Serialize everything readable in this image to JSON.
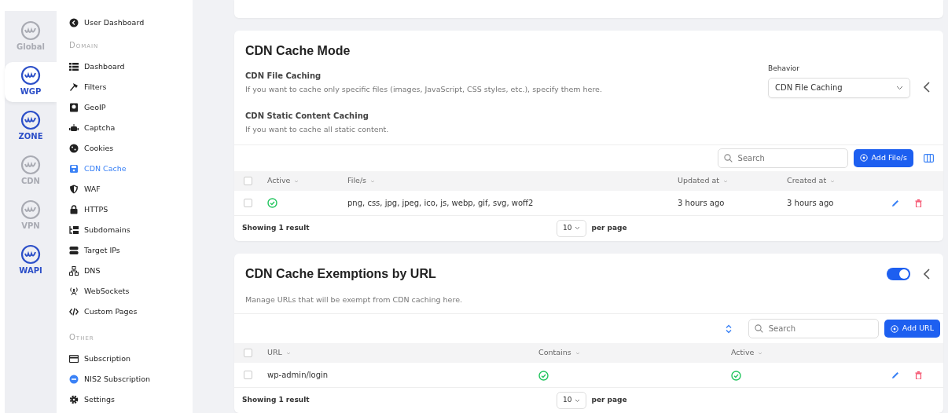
{
  "rail": [
    {
      "label": "Global",
      "selected": false,
      "disabled": true
    },
    {
      "label": "WGP",
      "selected": true,
      "disabled": false
    },
    {
      "label": "ZONE",
      "selected": false,
      "disabled": false
    },
    {
      "label": "CDN",
      "selected": false,
      "disabled": true
    },
    {
      "label": "VPN",
      "selected": false,
      "disabled": true
    },
    {
      "label": "WAPI",
      "selected": false,
      "disabled": false
    }
  ],
  "sidebar": {
    "top_item": {
      "label": "User Dashboard",
      "selected": false
    },
    "sections": [
      {
        "heading": "Domain",
        "items": [
          {
            "label": "Dashboard",
            "selected": false
          },
          {
            "label": "Filters",
            "selected": false
          },
          {
            "label": "GeoIP",
            "selected": false
          },
          {
            "label": "Captcha",
            "selected": false
          },
          {
            "label": "Cookies",
            "selected": false
          },
          {
            "label": "CDN Cache",
            "selected": true
          },
          {
            "label": "WAF",
            "selected": false
          },
          {
            "label": "HTTPS",
            "selected": false
          },
          {
            "label": "Subdomains",
            "selected": false
          },
          {
            "label": "Target IPs",
            "selected": false
          },
          {
            "label": "DNS",
            "selected": false
          },
          {
            "label": "WebSockets",
            "selected": false
          },
          {
            "label": "Custom Pages",
            "selected": false
          }
        ]
      },
      {
        "heading": "Other",
        "items": [
          {
            "label": "Subscription",
            "selected": false
          },
          {
            "label": "NIS2 Subscription",
            "selected": false
          },
          {
            "label": "Settings",
            "selected": false
          }
        ]
      }
    ]
  },
  "cards": [
    {
      "title": "CDN Cache Mode",
      "options": [
        {
          "title": "CDN File Caching",
          "description": "If you want to cache only specific files (images, JavaScript, CSS styles, etc.), specify them here."
        },
        {
          "title": "CDN Static Content Caching",
          "description": "If you want to cache all static content."
        }
      ],
      "behavior": {
        "label": "Behavior",
        "value": "CDN File Caching"
      },
      "expanded": false,
      "toolbar": {
        "sort_toggle": false,
        "search_placeholder": "Search",
        "add_button": "Add File/s",
        "column_picker": true
      },
      "table": {
        "all_selected": false,
        "columns": [
          {
            "label": "Active",
            "kind": "check"
          },
          {
            "label": "File/s",
            "kind": "text"
          },
          {
            "label": "Updated at",
            "kind": "text"
          },
          {
            "label": "Created at",
            "kind": "text"
          }
        ],
        "rows": [
          {
            "selected": false,
            "cells": [
              true,
              "png, css, jpg, jpeg, ico, js, webp, gif, svg, woff2",
              "3 hours ago",
              "3 hours ago"
            ]
          }
        ]
      },
      "footer": {
        "summary": "Showing 1 result",
        "page_size": "10",
        "per_page_label": "per page"
      }
    },
    {
      "title": "CDN Cache Exemptions by URL",
      "description": "Manage URLs that will be exempt from CDN caching here.",
      "toggle_on": true,
      "expanded": false,
      "toolbar": {
        "sort_toggle": true,
        "search_placeholder": "Search",
        "add_button": "Add URL",
        "column_picker": false
      },
      "table": {
        "all_selected": false,
        "columns": [
          {
            "label": "URL",
            "kind": "text"
          },
          {
            "label": "Contains",
            "kind": "check"
          },
          {
            "label": "Active",
            "kind": "check"
          }
        ],
        "rows": [
          {
            "selected": false,
            "cells": [
              "wp-admin/login",
              true,
              true
            ]
          }
        ]
      },
      "footer": {
        "summary": "Showing 1 result",
        "page_size": "10",
        "per_page_label": "per page"
      }
    }
  ]
}
